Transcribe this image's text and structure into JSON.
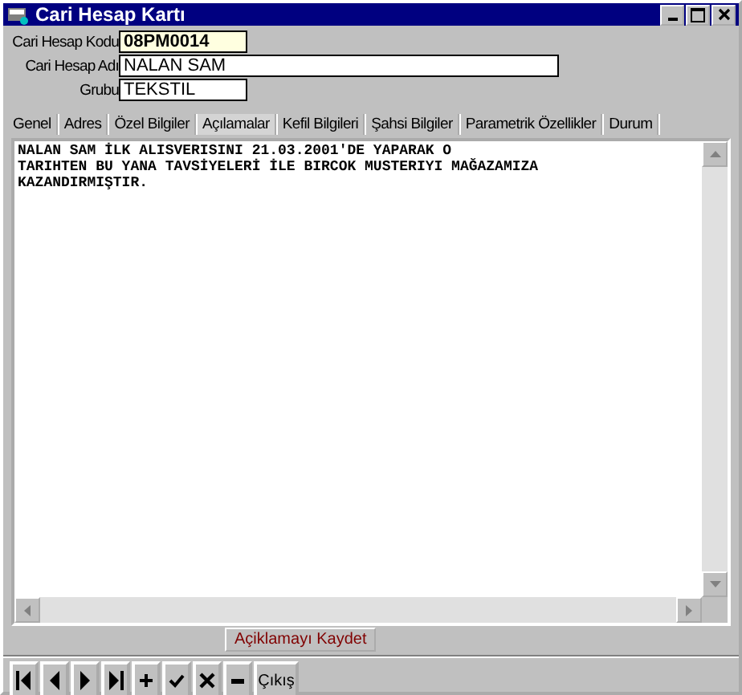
{
  "window": {
    "title": "Cari Hesap Kartı"
  },
  "fields": [
    {
      "label": "Cari Hesap Kodu",
      "value": "08PM0014",
      "kind": "code"
    },
    {
      "label": "Cari Hesap Adı",
      "value": "NALAN SAM",
      "kind": "wide"
    },
    {
      "label": "Grubu",
      "value": "TEKSTIL",
      "kind": "short"
    }
  ],
  "tabs": [
    {
      "label": "Genel",
      "selected": false
    },
    {
      "label": "Adres",
      "selected": false
    },
    {
      "label": "Özel Bilgiler",
      "selected": false
    },
    {
      "label": "Açılamalar",
      "selected": true
    },
    {
      "label": "Kefil Bilgileri",
      "selected": false
    },
    {
      "label": "Şahsi Bilgiler",
      "selected": false
    },
    {
      "label": "Parametrik Özellikler",
      "selected": false
    },
    {
      "label": "Durum",
      "selected": false
    }
  ],
  "memo": {
    "lines": [
      "NALAN SAM İLK ALISVERISINI 21.03.2001'DE YAPARAK O",
      "TARIHTEN BU YANA TAVSİYELERİ İLE BIRCOK MUSTERIYI MAĞAZAMIZA",
      "KAZANDIRMIŞTIR."
    ]
  },
  "save_button": {
    "label": "Açiklamayı Kaydet"
  },
  "toolbar": [
    {
      "kind": "first"
    },
    {
      "kind": "prev"
    },
    {
      "kind": "next"
    },
    {
      "kind": "last"
    },
    {
      "kind": "add"
    },
    {
      "kind": "confirm"
    },
    {
      "kind": "cancel"
    },
    {
      "kind": "delete"
    },
    {
      "kind": "text",
      "label": "Çıkış"
    }
  ]
}
